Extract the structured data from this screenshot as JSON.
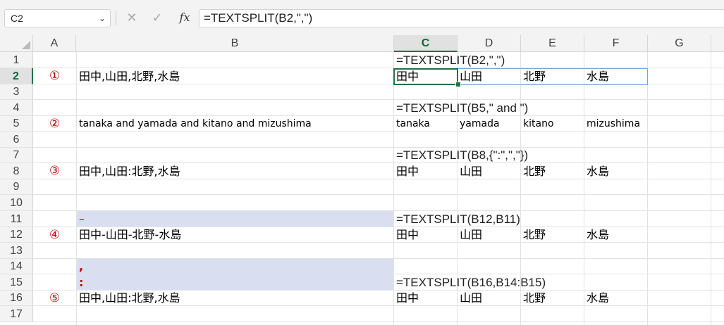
{
  "formula_bar": {
    "name_box": "C2",
    "cancel_icon": "✕",
    "enter_icon": "✓",
    "fx_label": "fx",
    "formula": "=TEXTSPLIT(B2,\",\")"
  },
  "columns": [
    "A",
    "B",
    "C",
    "D",
    "E",
    "F",
    "G"
  ],
  "active_column": "C",
  "rows": [
    "1",
    "2",
    "3",
    "4",
    "5",
    "6",
    "7",
    "8",
    "9",
    "10",
    "11",
    "12",
    "13",
    "14",
    "15",
    "16",
    "17"
  ],
  "active_row": "2",
  "cells": {
    "C1": "=TEXTSPLIT(B2,\",\")",
    "A2": "①",
    "B2": "田中,山田,北野,水島",
    "C2": "田中",
    "D2": "山田",
    "E2": "北野",
    "F2": "水島",
    "C4": "=TEXTSPLIT(B5,\" and \")",
    "A5": "②",
    "B5": "tanaka and yamada and kitano and mizushima",
    "C5": "tanaka",
    "D5": "yamada",
    "E5": "kitano",
    "F5": "mizushima",
    "C7": "=TEXTSPLIT(B8,{\":\",\",\"})",
    "A8": "③",
    "B8": "田中,山田:北野,水島",
    "C8": "田中",
    "D8": "山田",
    "E8": "北野",
    "F8": "水島",
    "B11": "–",
    "C11": "=TEXTSPLIT(B12,B11)",
    "A12": "④",
    "B12": "田中-山田-北野-水島",
    "C12": "田中",
    "D12": "山田",
    "E12": "北野",
    "F12": "水島",
    "B14": ",",
    "B15": ":",
    "C15": "=TEXTSPLIT(B16,B14:B15)",
    "A16": "⑤",
    "B16": "田中,山田:北野,水島",
    "C16": "田中",
    "D16": "山田",
    "E16": "北野",
    "F16": "水島"
  },
  "colors": {
    "accent": "#207245",
    "highlight_fill": "#d9dff1",
    "number_marker": "#c00000"
  }
}
